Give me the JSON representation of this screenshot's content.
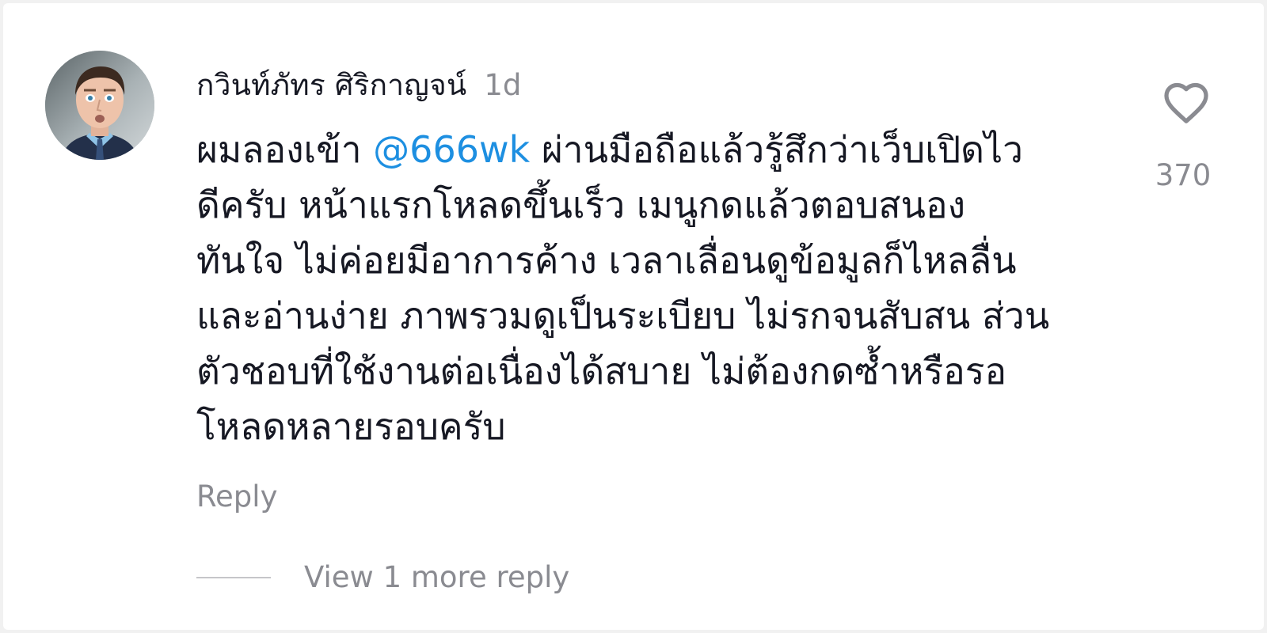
{
  "comment": {
    "username": "กวินท์ภัทร ศิริกาญจน์",
    "time_ago": "1d",
    "avatar_icon": "profile-photo",
    "body_lines": [
      [
        "ผมลองเข้า ",
        "@666wk",
        " ผ่านมือถือแล้วรู้สึกว่าเว็บเปิดไว"
      ],
      [
        "ดีครับ หน้าแรกโหลดขึ้นเร็ว เมนูกดแล้วตอบสนอง"
      ],
      [
        "ทันใจ ไม่ค่อยมีอาการค้าง เวลาเลื่อนดูข้อมูลก็ไหลลื่น"
      ],
      [
        "และอ่านง่าย ภาพรวมดูเป็นระเบียบ ไม่รกจนสับสน ส่วน"
      ],
      [
        "ตัวชอบที่ใช้งานต่อเนื่องได้สบาย ไม่ต้องกดซ้ำหรือรอ"
      ],
      [
        "โหลดหลายรอบครับ"
      ]
    ],
    "mention": "@666wk",
    "mention_color": "#1d8fe1",
    "like_icon": "heart-outline-icon",
    "like_count": "370",
    "reply_label": "Reply",
    "view_more_label": "View 1 more reply"
  }
}
